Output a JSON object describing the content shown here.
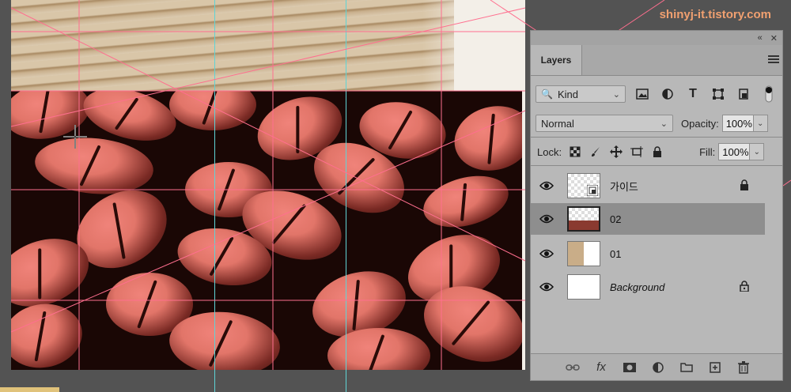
{
  "watermark": "shinyj-it.tistory.com",
  "panel": {
    "tab_label": "Layers",
    "filter_kind": "Kind",
    "blend_mode": "Normal",
    "opacity_label": "Opacity:",
    "opacity_value": "100%",
    "lock_label": "Lock:",
    "fill_label": "Fill:",
    "fill_value": "100%",
    "layers": [
      {
        "name": "가이드",
        "visible": true,
        "locked": true,
        "selected": false,
        "italic": false
      },
      {
        "name": "02",
        "visible": true,
        "locked": false,
        "selected": true,
        "italic": false
      },
      {
        "name": "01",
        "visible": true,
        "locked": false,
        "selected": false,
        "italic": false
      },
      {
        "name": "Background",
        "visible": true,
        "locked": true,
        "selected": false,
        "italic": true
      }
    ],
    "footer_icons": [
      "link-icon",
      "fx-icon",
      "mask-icon",
      "adjustment-icon",
      "folder-icon",
      "new-layer-icon",
      "trash-icon"
    ]
  },
  "colors": {
    "accent_watermark": "#f0a070",
    "guide": "#5fd4d6",
    "smart_guide": "#ff6f8f",
    "panel_bg": "#b8b8b8",
    "selected_layer": "#8e8e8e"
  }
}
